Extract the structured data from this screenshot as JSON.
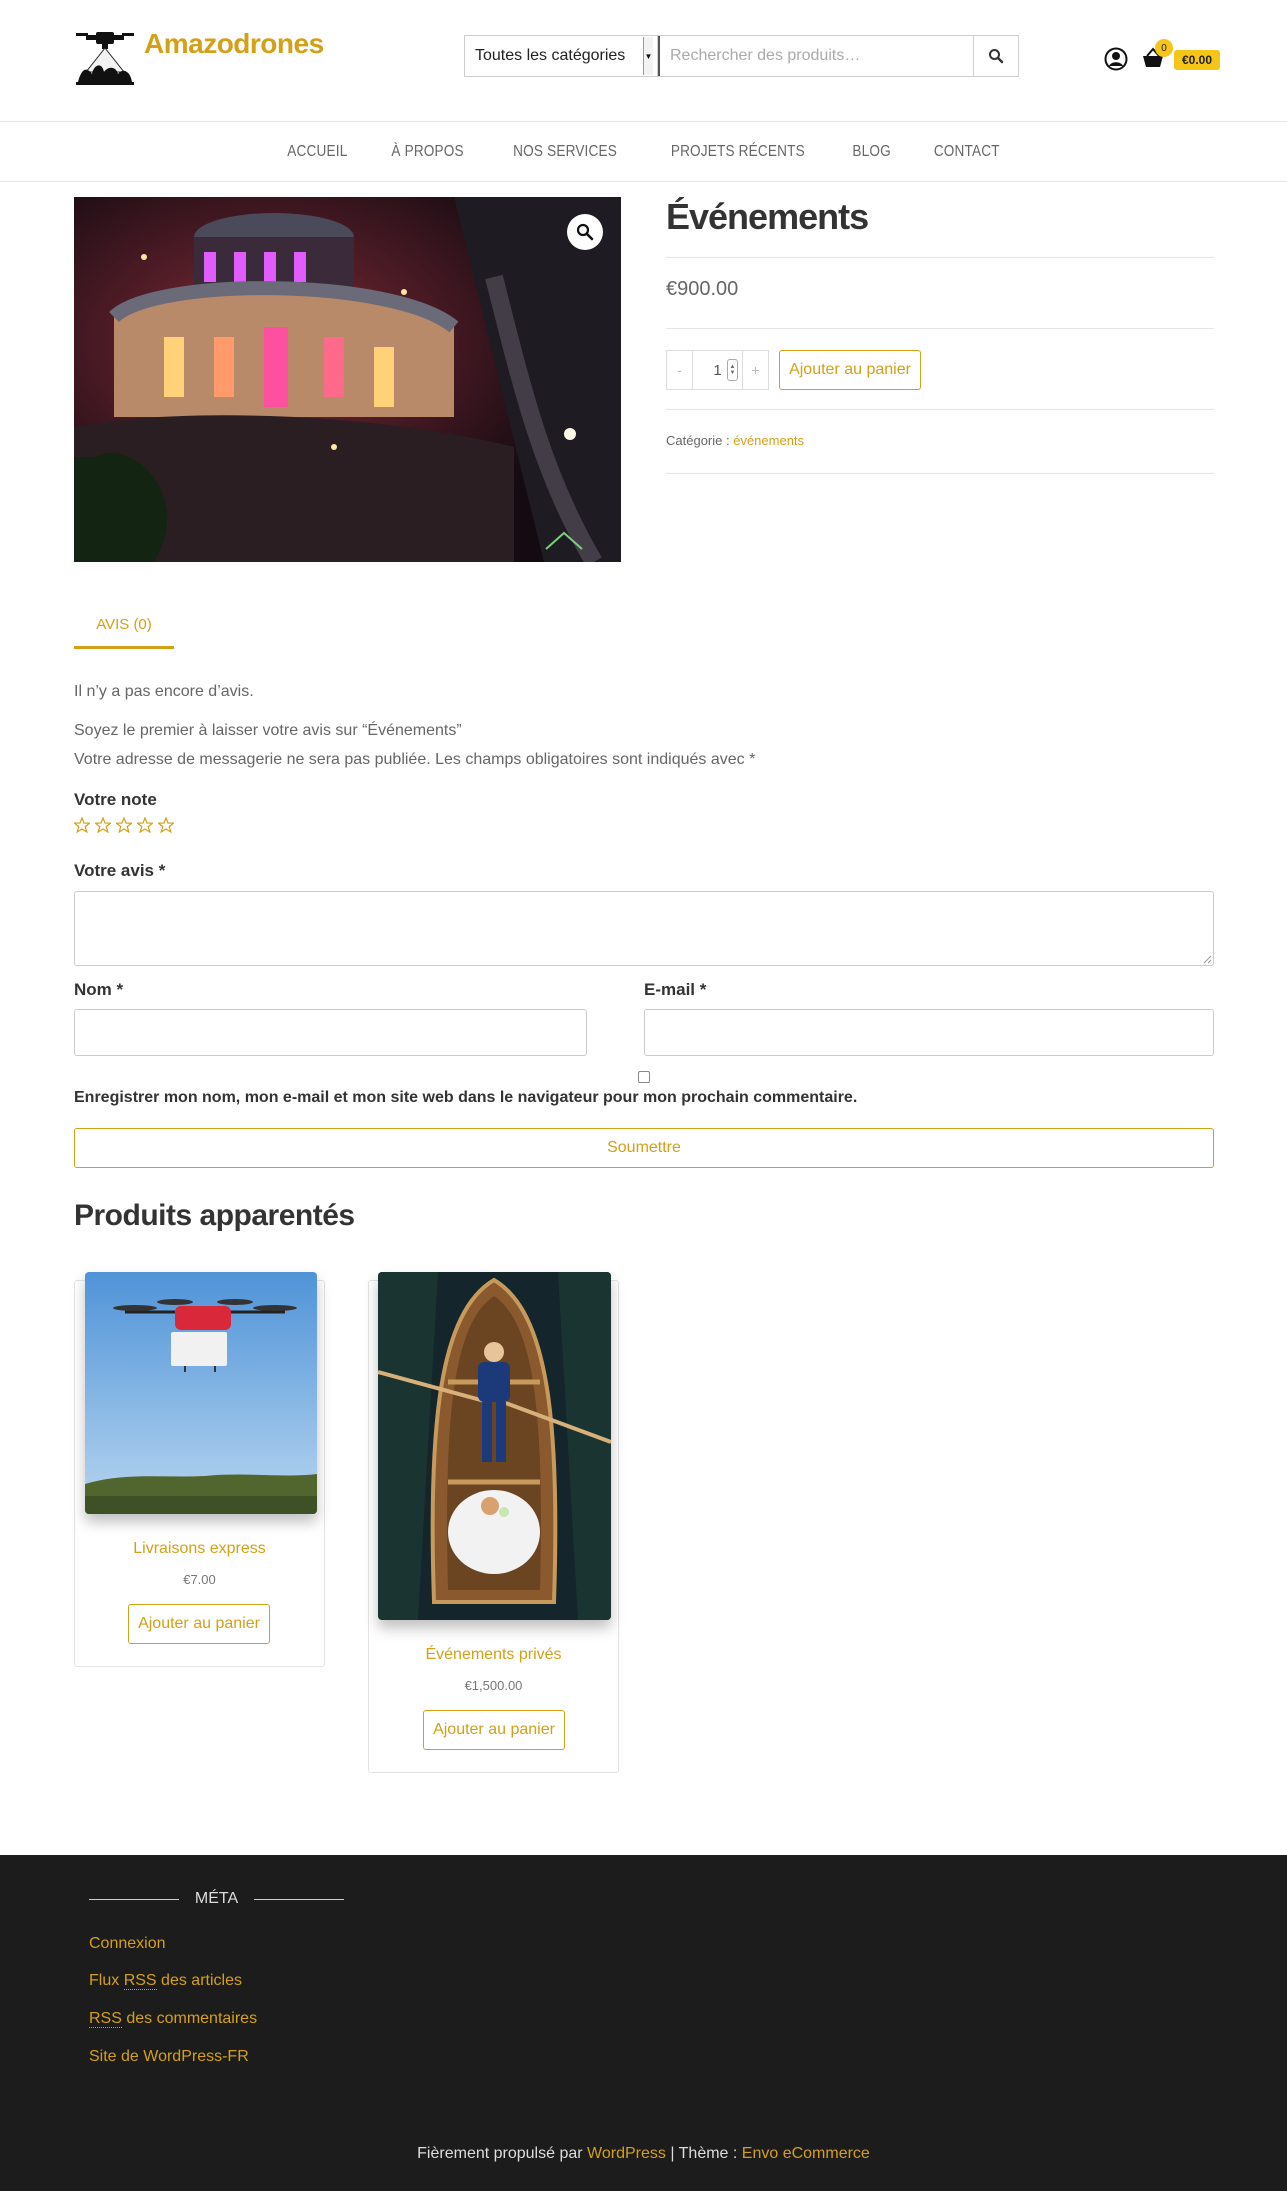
{
  "header": {
    "site_title": "Amazodrones",
    "category_select": "Toutes les catégories",
    "search_placeholder": "Rechercher des produits…",
    "cart_count": "0",
    "cart_amount": "€0.00"
  },
  "nav": {
    "items": [
      "ACCUEIL",
      "À PROPOS",
      "NOS SERVICES",
      "PROJETS RÉCENTS",
      "BLOG",
      "CONTACT"
    ]
  },
  "product": {
    "title": "Événements",
    "price": "€900.00",
    "quantity": "1",
    "qty_minus": "-",
    "qty_plus": "+",
    "add_to_cart": "Ajouter au panier",
    "category_label": "Catégorie :",
    "category_value": "événements"
  },
  "reviews": {
    "tab_label": "AVIS (0)",
    "no_reviews": "Il n’y a pas encore d’avis.",
    "be_first": "Soyez le premier à laisser votre avis sur “Événements”",
    "email_notice": "Votre adresse de messagerie ne sera pas publiée. Les champs obligatoires sont indiqués avec *",
    "rating_label": "Votre note",
    "review_label": "Votre avis",
    "name_label": "Nom",
    "email_label": "E-mail",
    "required_mark": "*",
    "save_info": "Enregistrer mon nom, mon e-mail et mon site web dans le navigateur pour mon prochain commentaire.",
    "submit": "Soumettre"
  },
  "related": {
    "title": "Produits apparentés",
    "products": [
      {
        "name": "Livraisons express",
        "price": "€7.00",
        "button": "Ajouter au panier"
      },
      {
        "name": "Événements privés",
        "price": "€1,500.00",
        "button": "Ajouter au panier"
      }
    ]
  },
  "footer": {
    "meta_title": "MÉTA",
    "links": {
      "login": "Connexion",
      "rss_articles_pre": "Flux",
      "rss_abbr": "RSS",
      "rss_articles_post": "des articles",
      "rss_comments_post": "des commentaires",
      "wp_fr": "Site de WordPress-FR"
    },
    "credit_pre": "Fièrement propulsé par",
    "credit_wp": "WordPress",
    "credit_mid": "| Thème :",
    "credit_theme": "Envo eCommerce"
  },
  "colors": {
    "accent": "#d4a017",
    "badge": "#f5c518",
    "footer_bg": "#1c1c1c"
  }
}
